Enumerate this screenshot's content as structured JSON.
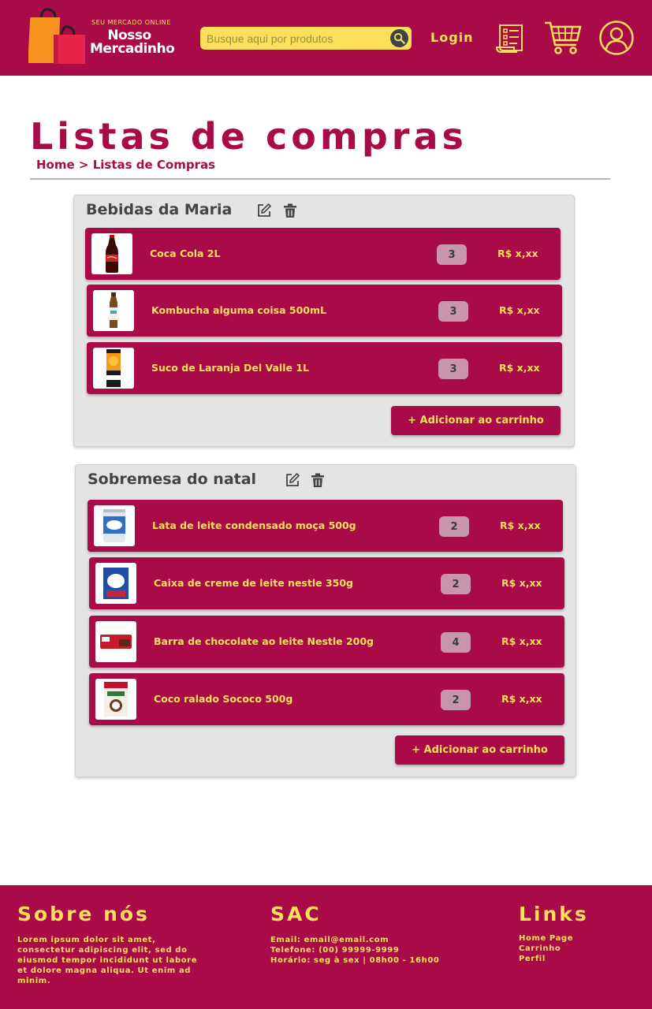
{
  "header": {
    "logo_tagline": "SEU MERCADO ONLINE",
    "logo_name": "Nosso Mercadinho",
    "search_placeholder": "Busque aqui por produtos",
    "login_label": "Login"
  },
  "page": {
    "title": "Listas de compras",
    "breadcrumb": {
      "home": "Home",
      "separator": " > ",
      "current": "Listas de Compras"
    }
  },
  "lists": [
    {
      "title": "Bebidas da Maria",
      "add_label": "+ Adicionar ao carrinho",
      "items": [
        {
          "name": "Coca Cola 2L",
          "qty": "3",
          "price": "R$ x,xx",
          "image": "coke-bottle"
        },
        {
          "name": "Kombucha alguma coisa 500mL",
          "qty": "3",
          "price": "R$ x,xx",
          "image": "kombucha-bottle"
        },
        {
          "name": "Suco de Laranja Del Valle 1L",
          "qty": "3",
          "price": "R$ x,xx",
          "image": "juice-carton"
        }
      ]
    },
    {
      "title": "Sobremesa do natal",
      "add_label": "+ Adicionar ao carrinho",
      "items": [
        {
          "name": "Lata de leite condensado moça 500g",
          "qty": "2",
          "price": "R$ x,xx",
          "image": "condensed-milk-can"
        },
        {
          "name": "Caixa de creme de leite nestle 350g",
          "qty": "2",
          "price": "R$ x,xx",
          "image": "cream-box"
        },
        {
          "name": "Barra de chocolate ao leite Nestle 200g",
          "qty": "4",
          "price": "R$ x,xx",
          "image": "chocolate-bar"
        },
        {
          "name": "Coco ralado Sococo 500g",
          "qty": "2",
          "price": "R$ x,xx",
          "image": "coconut-pack"
        }
      ]
    }
  ],
  "footer": {
    "about_title": "Sobre nós",
    "about_text": "Lorem ipsum dolor sit amet, consectetur adipiscing elit, sed do eiusmod tempor incididunt ut labore et dolore magna aliqua. Ut enim ad minim.",
    "sac_title": "SAC",
    "sac_email": "Email: email@email.com",
    "sac_phone": "Telefone: (00) 99999-9999",
    "sac_hours": "Horário: seg à sex | 08h00 - 16h00",
    "links_title": "Links",
    "links": [
      "Home Page",
      "Carrinho",
      "Perfil"
    ]
  },
  "colors": {
    "brand": "#a90b49",
    "accent": "#fde05a",
    "card_bg": "#e4e4e4",
    "qty_bg": "#c796ab"
  }
}
